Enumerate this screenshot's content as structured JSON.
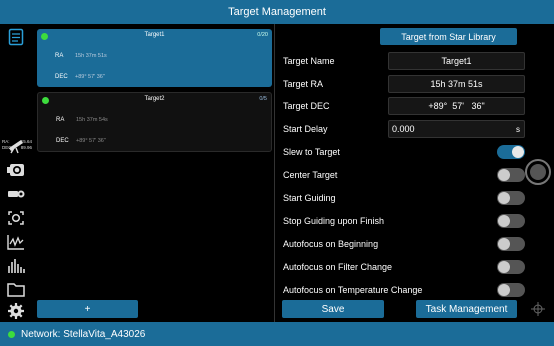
{
  "title": "Target Management",
  "sidebar": {
    "radec": {
      "ra_label": "RA:",
      "ra_value": "15.64",
      "dec_label": "DEC:",
      "dec_value": "89.96"
    }
  },
  "targets": [
    {
      "name": "Target1",
      "count": "0/20",
      "ra_label": "RA",
      "ra_value": "15h 37m 51s",
      "dec_label": "DEC",
      "dec_value": "+89° 57' 36\""
    },
    {
      "name": "Target2",
      "count": "0/5",
      "ra_label": "RA",
      "ra_value": "15h 37m 54s",
      "dec_label": "DEC",
      "dec_value": "+89° 57' 36\""
    }
  ],
  "add_button": "+",
  "form": {
    "star_library_button": "Target from Star Library",
    "target_name_label": "Target Name",
    "target_name_value": "Target1",
    "target_ra_label": "Target RA",
    "target_ra_value": "15h 37m 51s",
    "target_dec_label": "Target DEC",
    "target_dec_value": "+89°  57'   36\"",
    "start_delay_label": "Start Delay",
    "start_delay_value": "0.000",
    "start_delay_unit": "s",
    "toggles": [
      {
        "label": "Slew to Target",
        "on": true
      },
      {
        "label": "Center Target",
        "on": false
      },
      {
        "label": "Start Guiding",
        "on": false
      },
      {
        "label": "Stop Guiding upon Finish",
        "on": false
      },
      {
        "label": "Autofocus on Beginning",
        "on": false
      },
      {
        "label": "Autofocus on Filter Change",
        "on": false
      },
      {
        "label": "Autofocus on Temperature Change",
        "on": false
      }
    ]
  },
  "save_button": "Save",
  "task_button": "Task Management",
  "status": {
    "network": "Network: StellaVita_A43026"
  },
  "colors": {
    "accent": "#1b6c98",
    "status_ok": "#3ddc3d"
  }
}
